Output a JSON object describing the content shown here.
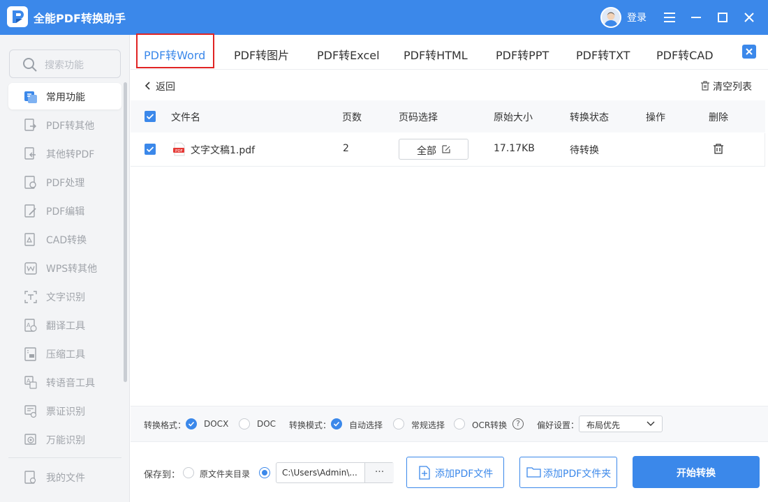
{
  "app": {
    "title": "全能PDF转换助手",
    "login": "登录"
  },
  "sidebar": {
    "search_placeholder": "搜索功能",
    "items": [
      {
        "label": "常用功能",
        "icon": "common-functions-icon"
      },
      {
        "label": "PDF转其他",
        "icon": "pdf-to-other-icon"
      },
      {
        "label": "其他转PDF",
        "icon": "other-to-pdf-icon"
      },
      {
        "label": "PDF处理",
        "icon": "pdf-process-icon"
      },
      {
        "label": "PDF编辑",
        "icon": "pdf-edit-icon"
      },
      {
        "label": "CAD转换",
        "icon": "cad-convert-icon"
      },
      {
        "label": "WPS转其他",
        "icon": "wps-convert-icon"
      },
      {
        "label": "文字识别",
        "icon": "text-recognition-icon"
      },
      {
        "label": "翻译工具",
        "icon": "translate-icon"
      },
      {
        "label": "压缩工具",
        "icon": "compress-icon"
      },
      {
        "label": "转语音工具",
        "icon": "speech-icon"
      },
      {
        "label": "票证识别",
        "icon": "ticket-recognition-icon"
      },
      {
        "label": "万能识别",
        "icon": "universal-recognition-icon"
      }
    ],
    "my_files": "我的文件"
  },
  "tabs": [
    {
      "label": "PDF转Word",
      "active": true
    },
    {
      "label": "PDF转图片"
    },
    {
      "label": "PDF转Excel"
    },
    {
      "label": "PDF转HTML"
    },
    {
      "label": "PDF转PPT"
    },
    {
      "label": "PDF转TXT"
    },
    {
      "label": "PDF转CAD"
    }
  ],
  "toolbar": {
    "back": "返回",
    "clear_list": "清空列表"
  },
  "table": {
    "headers": [
      "文件名",
      "页数",
      "页码选择",
      "原始大小",
      "转换状态",
      "操作",
      "删除"
    ],
    "rows": [
      {
        "file_name": "文字文稿1.pdf",
        "pages": "2",
        "page_select": "全部",
        "size": "17.17KB",
        "status": "待转换",
        "checked": true
      }
    ]
  },
  "options": {
    "format_label": "转换格式：",
    "format_options": [
      "DOCX",
      "DOC"
    ],
    "format_selected": "DOCX",
    "mode_label": "转换模式：",
    "mode_options": [
      "自动选择",
      "常规选择",
      "OCR转换"
    ],
    "mode_selected": "自动选择",
    "help": "?",
    "pref_label": "偏好设置：",
    "pref_value": "布局优先"
  },
  "save": {
    "label": "保存到：",
    "option_source": "原文件夹目录",
    "path": "C:\\Users\\Admin\\...",
    "more": "···"
  },
  "buttons": {
    "add_file": "添加PDF文件",
    "add_folder": "添加PDF文件夹",
    "start": "开始转换"
  },
  "colors": {
    "accent": "#3b88ea",
    "highlight_border": "#e02424",
    "sidebar_bg": "#f3f4f6"
  }
}
